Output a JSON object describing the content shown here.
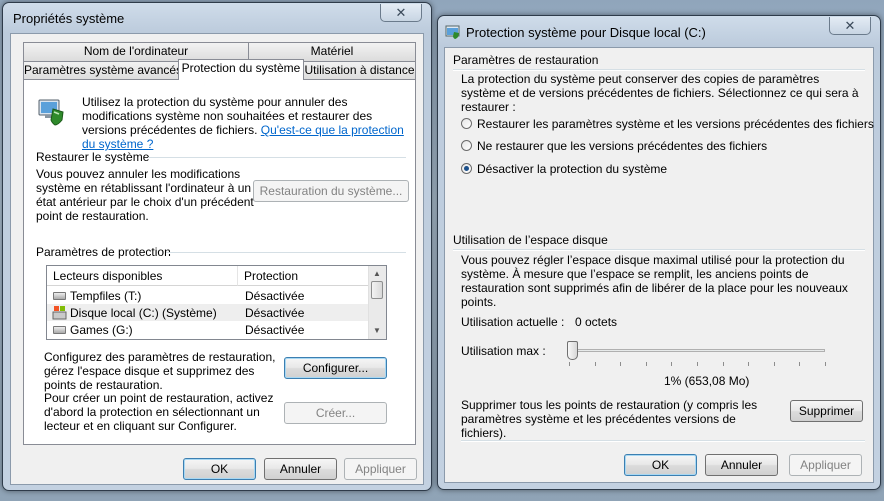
{
  "sysprops": {
    "title": "Propriétés système",
    "tabs_row1": [
      "Nom de l'ordinateur",
      "Matériel"
    ],
    "tabs_row2": [
      "Paramètres système avancés",
      "Protection du système",
      "Utilisation à distance"
    ],
    "intro": "Utilisez la protection du système pour annuler des modifications système non souhaitées et restaurer des versions précédentes de fichiers.",
    "intro_link": "Qu'est-ce que la protection du système ?",
    "restore_group": "Restaurer le système",
    "restore_text": "Vous pouvez annuler les modifications système en rétablissant l'ordinateur à un état antérieur par le choix d'un précédent point de restauration.",
    "restore_button": "Restauration du système...",
    "protection_group": "Paramètres de protection",
    "columns": [
      "Lecteurs disponibles",
      "Protection"
    ],
    "drives": [
      {
        "name": "Tempfiles (T:)",
        "status": "Désactivée"
      },
      {
        "name": "Disque local (C:) (Système)",
        "status": "Désactivée"
      },
      {
        "name": "Games (G:)",
        "status": "Désactivée"
      }
    ],
    "configure_text": "Configurez des paramètres de restauration, gérez l'espace disque et supprimez des points de restauration.",
    "configure_button": "Configurer...",
    "create_text": "Pour créer un point de restauration, activez d'abord la protection en sélectionnant un lecteur et en cliquant sur Configurer.",
    "create_button": "Créer...",
    "ok": "OK",
    "cancel": "Annuler",
    "apply": "Appliquer"
  },
  "protection": {
    "title": "Protection système pour Disque local (C:)",
    "restore_group": "Paramètres de restauration",
    "restore_desc": "La protection du système peut conserver des copies de paramètres système et de versions précédentes de fichiers. Sélectionnez ce qui sera à restaurer :",
    "options": [
      "Restaurer les paramètres système et les versions précédentes des fichiers",
      "Ne restaurer que les versions précédentes des fichiers",
      "Désactiver la protection du système"
    ],
    "selected_option": 2,
    "usage_group": "Utilisation de l’espace disque",
    "usage_desc": "Vous pouvez régler l’espace disque maximal utilisé pour la protection du système. À mesure que l’espace se remplit, les anciens points de restauration sont supprimés afin de libérer de la place pour les nouveaux points.",
    "current_label": "Utilisation actuelle :",
    "current_value": "0 octets",
    "max_label": "Utilisation max :",
    "max_percent": 1,
    "max_value": "1% (653,08 Mo)",
    "delete_text": "Supprimer tous les points de restauration (y compris les paramètres système et les précédentes versions de fichiers).",
    "delete_button": "Supprimer",
    "ok": "OK",
    "cancel": "Annuler",
    "apply": "Appliquer"
  },
  "icons": {
    "close": "close-icon",
    "shield": "system-protection-icon",
    "drive": "drive-icon",
    "window": "window-icon"
  },
  "colors": {
    "link": "#0066cc",
    "titlebar": "#bccbdc",
    "desktop": "#90a5bb"
  }
}
